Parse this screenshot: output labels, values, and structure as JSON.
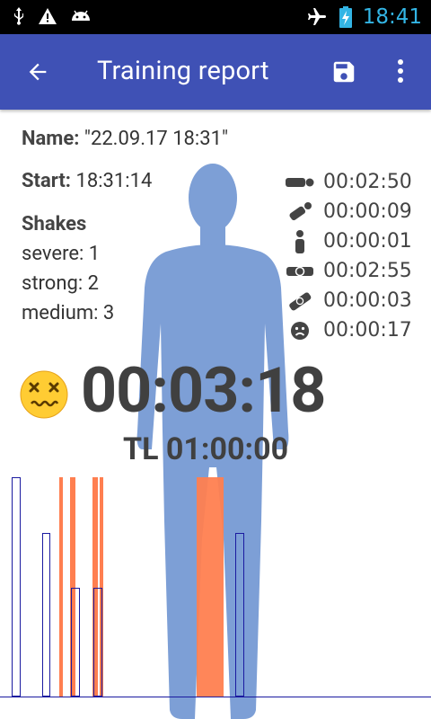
{
  "status": {
    "time": "18:41"
  },
  "appbar": {
    "title": "Training report"
  },
  "report": {
    "name_label": "Name:",
    "name_value": "\"22.09.17 18:31\"",
    "start_label": "Start:",
    "start_value": "18:31:14",
    "shakes_title": "Shakes",
    "severe": "severe: 1",
    "strong": "strong: 2",
    "medium": "medium: 3",
    "positions": [
      {
        "icon": "lying-icon",
        "time": "00:02:50"
      },
      {
        "icon": "tilted-icon",
        "time": "00:00:09"
      },
      {
        "icon": "standing-icon",
        "time": "00:00:01"
      },
      {
        "icon": "lying-front-icon",
        "time": "00:02:55"
      },
      {
        "icon": "tilted-alt-icon",
        "time": "00:00:03"
      },
      {
        "icon": "sad-face-icon",
        "time": "00:00:17"
      }
    ],
    "total_time": "00:03:18",
    "time_limit": "TL 01:00:00"
  },
  "colors": {
    "appbar": "#3f51b5",
    "figure": "#7d9fd6",
    "bar_orange": "#ff7f50",
    "bar_outline": "#1a1aa0"
  }
}
